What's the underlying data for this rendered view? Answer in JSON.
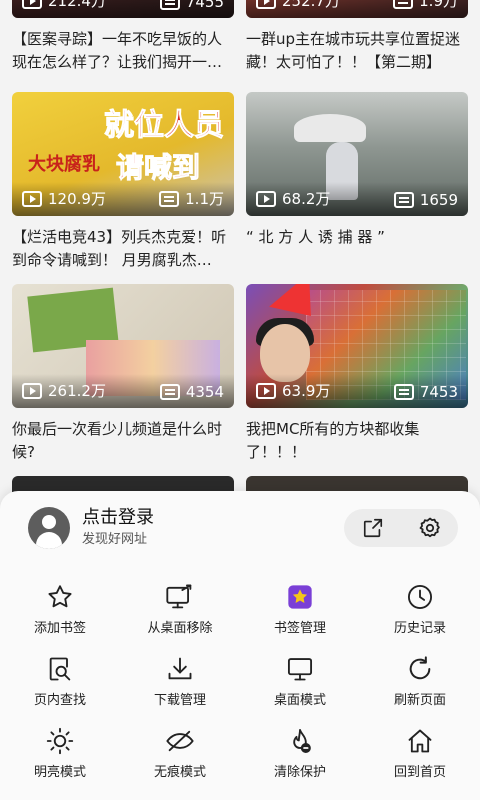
{
  "feed": {
    "cards": [
      {
        "views": "212.4万",
        "danmaku": "7455",
        "title": "",
        "thumb": "t-top1"
      },
      {
        "views": "252.7万",
        "danmaku": "1.9万",
        "title": "",
        "thumb": "t-top2"
      },
      {
        "views": "120.9万",
        "danmaku": "1.1万",
        "title": "【烂活电竞43】列兵杰克爱！听到命令请喊到！ 月男腐乳杰…",
        "thumb": "t-yellow"
      },
      {
        "views": "68.2万",
        "danmaku": "1659",
        "title": "“ 北 方 人 诱 捕 器 ”",
        "thumb": "t-mist"
      },
      {
        "views": "261.2万",
        "danmaku": "4354",
        "title": "你最后一次看少儿频道是什么时候?",
        "thumb": "t-paper"
      },
      {
        "views": "63.9万",
        "danmaku": "7453",
        "title": "我把MC所有的方块都收集了！！！",
        "thumb": "t-mc"
      }
    ],
    "top_titles": [
      "【医案寻踪】一年不吃早饭的人现在怎么样了？让我们揭开一…",
      "一群up主在城市玩共享位置捉迷藏！太可怕了！！【第二期】"
    ],
    "thumb_texts": {
      "yellow_big": "就位人员",
      "yellow_sub": "大块腐乳",
      "yellow_call": "请喊到"
    }
  },
  "sheet": {
    "account": {
      "name": "点击登录",
      "subtitle": "发现好网址"
    },
    "actions": [
      {
        "label": "添加书签",
        "icon": "star-icon"
      },
      {
        "label": "从桌面移除",
        "icon": "remove-from-desktop-icon"
      },
      {
        "label": "书签管理",
        "icon": "bookmark-manager-icon"
      },
      {
        "label": "历史记录",
        "icon": "history-clock-icon"
      },
      {
        "label": "页内查找",
        "icon": "find-in-page-icon"
      },
      {
        "label": "下载管理",
        "icon": "download-icon"
      },
      {
        "label": "桌面模式",
        "icon": "desktop-monitor-icon"
      },
      {
        "label": "刷新页面",
        "icon": "refresh-icon"
      },
      {
        "label": "明亮模式",
        "icon": "sun-icon"
      },
      {
        "label": "无痕模式",
        "icon": "incognito-icon"
      },
      {
        "label": "清除保护",
        "icon": "clear-protection-icon"
      },
      {
        "label": "回到首页",
        "icon": "home-icon"
      }
    ]
  },
  "colors": {
    "accent_badge": "#f5c518",
    "badge_bg": "#7a3fd6",
    "text": "#222222"
  }
}
